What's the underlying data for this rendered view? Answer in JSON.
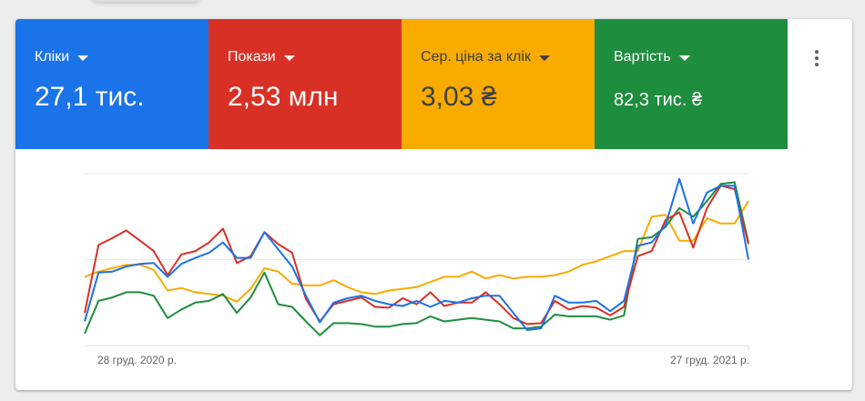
{
  "colors": {
    "blue": "#1a73e8",
    "red": "#d93025",
    "yellow": "#f9ab00",
    "green": "#1e8e3e"
  },
  "metrics": [
    {
      "label": "Кліки",
      "value": "27,1 тис.",
      "color": "#1a73e8"
    },
    {
      "label": "Покази",
      "value": "2,53 млн",
      "color": "#d93025"
    },
    {
      "label": "Сер. ціна за клік",
      "value": "3,03 ₴",
      "color": "#f9ab00"
    },
    {
      "label": "Вартість",
      "value": "82,3 тис. ₴",
      "color": "#1e8e3e"
    }
  ],
  "more_icon": "more-vert-icon",
  "chart_data": {
    "type": "line",
    "x_start_label": "28 груд. 2020 р.",
    "x_end_label": "27 груд. 2021 р.",
    "series": [
      {
        "name": "Кліки",
        "color": "#1a73e8",
        "values": [
          0.28,
          0.85,
          0.86,
          0.92,
          0.95,
          0.96,
          0.8,
          0.95,
          1.02,
          1.08,
          1.2,
          1.02,
          1.02,
          1.32,
          1.12,
          0.92,
          0.58,
          0.27,
          0.5,
          0.55,
          0.58,
          0.52,
          0.48,
          0.46,
          0.52,
          0.45,
          0.52,
          0.5,
          0.55,
          0.58,
          0.58,
          0.38,
          0.18,
          0.2,
          0.58,
          0.5,
          0.5,
          0.52,
          0.4,
          0.52,
          1.16,
          1.2,
          1.4,
          1.94,
          1.42,
          1.78,
          1.86,
          1.86,
          1.0
        ]
      },
      {
        "name": "Покази",
        "color": "#d93025",
        "values": [
          0.38,
          1.17,
          1.25,
          1.34,
          1.22,
          1.1,
          0.82,
          1.06,
          1.1,
          1.2,
          1.36,
          0.96,
          1.04,
          1.32,
          1.18,
          1.08,
          0.54,
          0.28,
          0.48,
          0.52,
          0.56,
          0.45,
          0.44,
          0.55,
          0.48,
          0.62,
          0.46,
          0.5,
          0.5,
          0.62,
          0.48,
          0.32,
          0.25,
          0.26,
          0.52,
          0.42,
          0.46,
          0.44,
          0.35,
          0.45,
          1.04,
          1.1,
          1.46,
          1.55,
          1.14,
          1.6,
          1.86,
          1.82,
          1.18
        ]
      },
      {
        "name": "Сер. ціна за клік",
        "color": "#f9ab00",
        "values": [
          0.8,
          0.86,
          0.9,
          0.94,
          0.94,
          0.88,
          0.64,
          0.67,
          0.62,
          0.6,
          0.58,
          0.51,
          0.66,
          0.9,
          0.86,
          0.72,
          0.7,
          0.7,
          0.76,
          0.68,
          0.62,
          0.6,
          0.64,
          0.66,
          0.68,
          0.74,
          0.8,
          0.8,
          0.86,
          0.78,
          0.82,
          0.78,
          0.8,
          0.8,
          0.82,
          0.86,
          0.94,
          0.98,
          1.04,
          1.1,
          1.1,
          1.5,
          1.52,
          1.22,
          1.22,
          1.48,
          1.42,
          1.42,
          1.68
        ]
      },
      {
        "name": "Вартість",
        "color": "#1e8e3e",
        "values": [
          0.14,
          0.52,
          0.56,
          0.62,
          0.62,
          0.58,
          0.32,
          0.42,
          0.5,
          0.52,
          0.6,
          0.38,
          0.56,
          0.85,
          0.48,
          0.45,
          0.28,
          0.12,
          0.26,
          0.26,
          0.25,
          0.22,
          0.22,
          0.25,
          0.26,
          0.34,
          0.28,
          0.3,
          0.32,
          0.3,
          0.28,
          0.2,
          0.2,
          0.22,
          0.36,
          0.34,
          0.34,
          0.34,
          0.3,
          0.35,
          1.24,
          1.26,
          1.38,
          1.6,
          1.5,
          1.68,
          1.88,
          1.9,
          1.2
        ]
      }
    ],
    "ylim": [
      0,
      2
    ],
    "grid": true
  }
}
